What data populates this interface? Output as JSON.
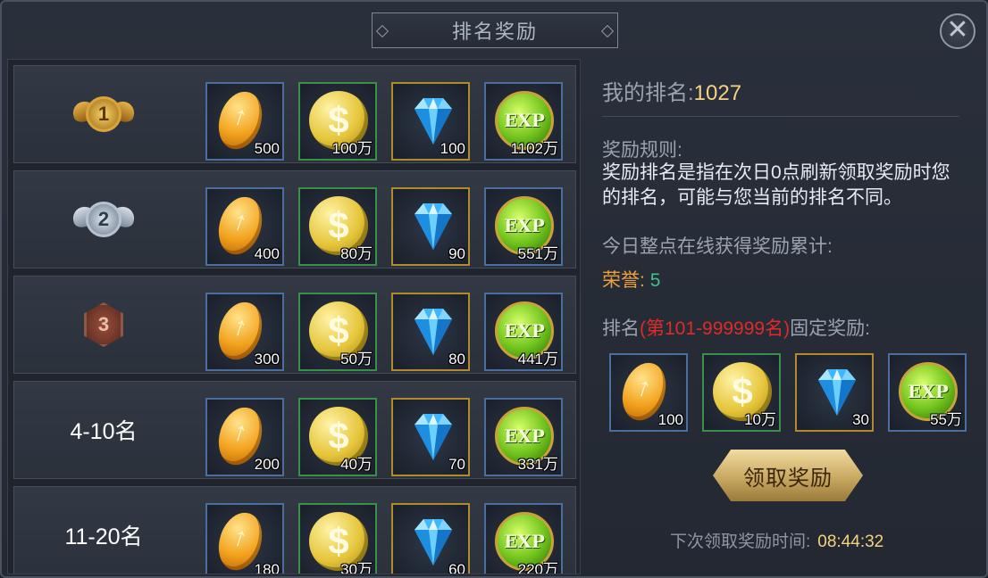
{
  "title": "排名奖励",
  "close_glyph": "✕",
  "reward_rows": [
    {
      "rank_type": "medal",
      "medal": "gold",
      "medal_text": "1",
      "rank_label": "",
      "rewards": [
        {
          "icon": "coin-orange-icon",
          "frame": "blue",
          "qty": "500"
        },
        {
          "icon": "coin-gold-icon",
          "frame": "green",
          "qty": "100万"
        },
        {
          "icon": "diamond-icon",
          "frame": "gold",
          "qty": "100"
        },
        {
          "icon": "exp-orb-icon",
          "frame": "blue",
          "qty": "1102万"
        }
      ]
    },
    {
      "rank_type": "medal",
      "medal": "silver",
      "medal_text": "2",
      "rank_label": "",
      "rewards": [
        {
          "icon": "coin-orange-icon",
          "frame": "blue",
          "qty": "400"
        },
        {
          "icon": "coin-gold-icon",
          "frame": "green",
          "qty": "80万"
        },
        {
          "icon": "diamond-icon",
          "frame": "gold",
          "qty": "90"
        },
        {
          "icon": "exp-orb-icon",
          "frame": "blue",
          "qty": "551万"
        }
      ]
    },
    {
      "rank_type": "medal",
      "medal": "bronze",
      "medal_text": "3",
      "rank_label": "",
      "rewards": [
        {
          "icon": "coin-orange-icon",
          "frame": "blue",
          "qty": "300"
        },
        {
          "icon": "coin-gold-icon",
          "frame": "green",
          "qty": "50万"
        },
        {
          "icon": "diamond-icon",
          "frame": "gold",
          "qty": "80"
        },
        {
          "icon": "exp-orb-icon",
          "frame": "blue",
          "qty": "441万"
        }
      ]
    },
    {
      "rank_type": "text",
      "medal": "",
      "medal_text": "",
      "rank_label": "4-10名",
      "rewards": [
        {
          "icon": "coin-orange-icon",
          "frame": "blue",
          "qty": "200"
        },
        {
          "icon": "coin-gold-icon",
          "frame": "green",
          "qty": "40万"
        },
        {
          "icon": "diamond-icon",
          "frame": "gold",
          "qty": "70"
        },
        {
          "icon": "exp-orb-icon",
          "frame": "blue",
          "qty": "331万"
        }
      ]
    },
    {
      "rank_type": "text",
      "medal": "",
      "medal_text": "",
      "rank_label": "11-20名",
      "rewards": [
        {
          "icon": "coin-orange-icon",
          "frame": "blue",
          "qty": "180"
        },
        {
          "icon": "coin-gold-icon",
          "frame": "green",
          "qty": "30万"
        },
        {
          "icon": "diamond-icon",
          "frame": "gold",
          "qty": "60"
        },
        {
          "icon": "exp-orb-icon",
          "frame": "blue",
          "qty": "220万"
        }
      ]
    }
  ],
  "info": {
    "my_rank_label": "我的排名:",
    "my_rank_value": "1027",
    "rules_title": "奖励规则:",
    "rules_text": "奖励排名是指在次日0点刷新领取奖励时您的排名，可能与您当前的排名不同。",
    "hourly_title": "今日整点在线获得奖励累计:",
    "honor_label": "荣誉:",
    "honor_value": "5",
    "fixed_prefix": "排名",
    "fixed_range": "(第101-999999名)",
    "fixed_suffix": "固定奖励:",
    "fixed_rewards": [
      {
        "icon": "coin-orange-icon",
        "frame": "blue",
        "qty": "100"
      },
      {
        "icon": "coin-gold-icon",
        "frame": "green",
        "qty": "10万"
      },
      {
        "icon": "diamond-icon",
        "frame": "gold",
        "qty": "30"
      },
      {
        "icon": "exp-orb-icon",
        "frame": "blue",
        "qty": "55万"
      }
    ],
    "claim_button": "领取奖励",
    "next_claim_label": "下次领取奖励时间:",
    "next_claim_time": "08:44:32"
  },
  "colors": {
    "value_gold": "#f5d27e",
    "range_red": "#e02a2a",
    "honor_orange": "#f0a03a",
    "honor_green": "#3fc28a"
  }
}
